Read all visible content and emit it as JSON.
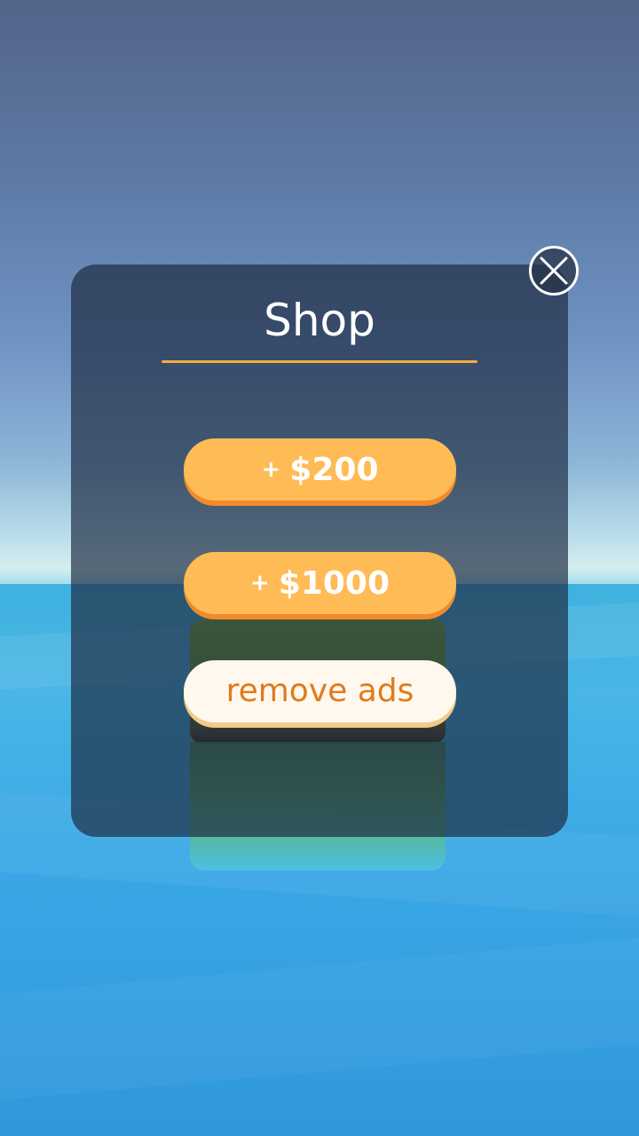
{
  "shop": {
    "title": "Shop",
    "buttons": [
      {
        "plus": "+",
        "label": "$200"
      },
      {
        "plus": "+",
        "label": "$1000"
      },
      {
        "label": "remove ads"
      }
    ]
  },
  "icons": {
    "close": "close-icon"
  },
  "colors": {
    "accent": "#f4ae3c",
    "button": "#ffbb55",
    "button_shadow": "#f2892b",
    "remove_ads_text": "#e07b1c"
  }
}
